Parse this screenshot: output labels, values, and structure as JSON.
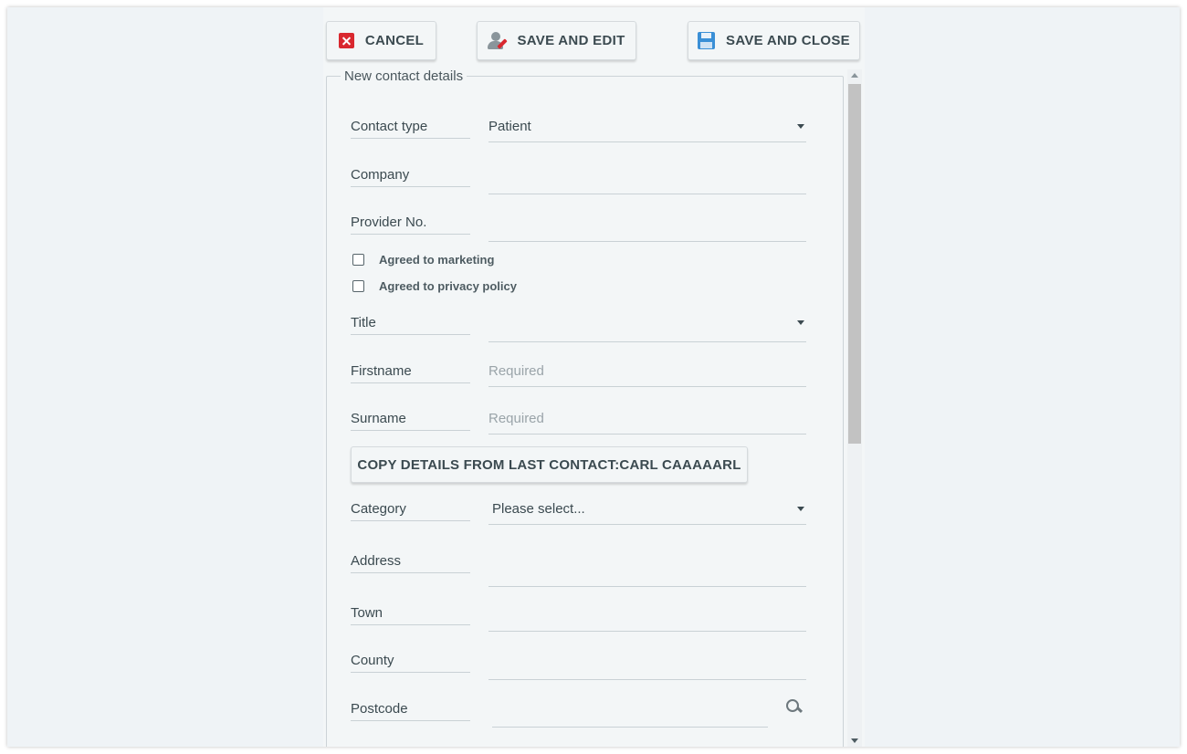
{
  "toolbar": {
    "cancel_label": "CANCEL",
    "save_edit_label": "SAVE AND EDIT",
    "save_close_label": "SAVE AND CLOSE"
  },
  "form": {
    "legend": "New contact details",
    "contact_type": {
      "label": "Contact type",
      "value": "Patient"
    },
    "company": {
      "label": "Company",
      "value": ""
    },
    "provider_no": {
      "label": "Provider No.",
      "value": ""
    },
    "agreed_marketing": {
      "label": "Agreed to marketing",
      "checked": false
    },
    "agreed_privacy": {
      "label": "Agreed to privacy policy",
      "checked": false
    },
    "title": {
      "label": "Title",
      "value": ""
    },
    "firstname": {
      "label": "Firstname",
      "placeholder": "Required",
      "value": ""
    },
    "surname": {
      "label": "Surname",
      "placeholder": "Required",
      "value": ""
    },
    "copy_button_label": "COPY DETAILS FROM LAST CONTACT:CARL CAAAAARL",
    "category": {
      "label": "Category",
      "value": "Please select..."
    },
    "address": {
      "label": "Address",
      "value": ""
    },
    "town": {
      "label": "Town",
      "value": ""
    },
    "county": {
      "label": "County",
      "value": ""
    },
    "postcode": {
      "label": "Postcode",
      "value": ""
    }
  },
  "icons": {
    "cancel": "close-box-icon",
    "save_edit": "user-edit-icon",
    "save_close": "floppy-disk-icon",
    "postcode_search": "search-icon",
    "dropdown": "caret-down-icon"
  },
  "colors": {
    "cancel_icon": "#d9282f",
    "save_icon": "#3a8fd6",
    "background": "#eff3f6",
    "panel": "#f3f6f7"
  }
}
